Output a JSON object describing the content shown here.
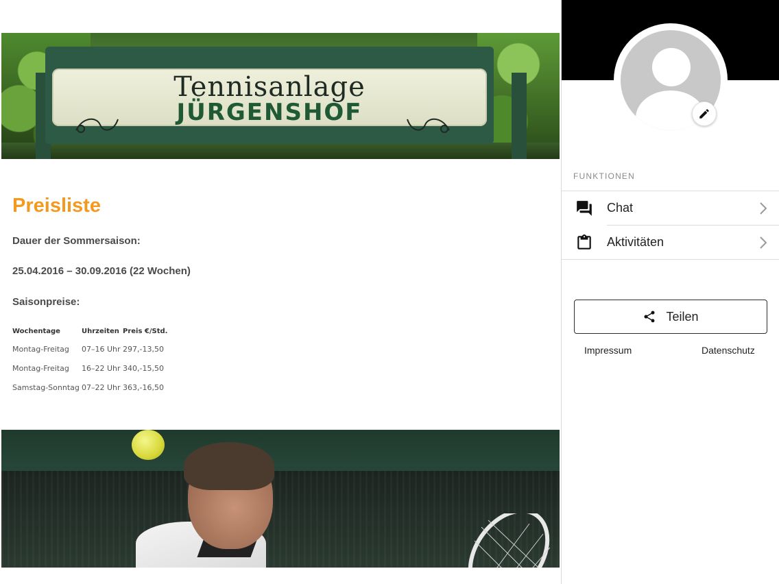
{
  "banner": {
    "sign_line1": "Tennisanlage",
    "sign_line2": "JÜRGENSHOF"
  },
  "content": {
    "title": "Preisliste",
    "season_label": "Dauer der Sommersaison:",
    "season_dates": "25.04.2016 – 30.09.2016 (22 Wochen)",
    "prices_label": "Saisonpreise:",
    "table": {
      "headers": [
        "Wochentage",
        "Uhrzeiten",
        "Preis €/Std."
      ],
      "rows": [
        [
          "Montag-Freitag",
          "07–16 Uhr",
          "297,-",
          "13,50"
        ],
        [
          "Montag-Freitag",
          "16–22 Uhr",
          "340,-",
          "15,50"
        ],
        [
          "Samstag-Sonntag",
          "07–22 Uhr",
          "363,-",
          "16,50"
        ]
      ]
    }
  },
  "sidebar": {
    "section_header": "FUNKTIONEN",
    "menu": [
      {
        "label": "Chat",
        "icon": "chat-icon"
      },
      {
        "label": "Aktivitäten",
        "icon": "clipboard-icon"
      }
    ],
    "share_label": "Teilen",
    "footer": {
      "impressum": "Impressum",
      "datenschutz": "Datenschutz"
    }
  },
  "colors": {
    "title_orange": "#f39a1e",
    "sidebar_header_bg": "#000000",
    "avatar_gray": "#c8c8c8"
  }
}
